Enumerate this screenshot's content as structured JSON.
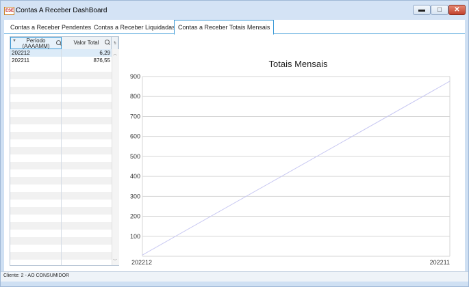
{
  "window": {
    "title": "Contas A Receber DashBoard",
    "icon_text": "ESE",
    "min_glyph": "▬",
    "max_glyph": "□",
    "close_glyph": "✕"
  },
  "tabs": [
    {
      "label": "Contas a Receber Pendentes"
    },
    {
      "label": "Contas a Receber Liquidadas"
    },
    {
      "label": "Contas a Receber Totais Mensais",
      "active": true
    }
  ],
  "grid": {
    "col1_line1": "Período",
    "col1_line2": "(AAAAMM)",
    "col2": "Valor Total",
    "rows": [
      {
        "periodo": "202212",
        "valor": "6,29",
        "selected": true
      },
      {
        "periodo": "202211",
        "valor": "876,55",
        "selected": false
      }
    ]
  },
  "chart_data": {
    "type": "line",
    "title": "Totais Mensais",
    "categories": [
      "202212",
      "202211"
    ],
    "series": [
      {
        "values": [
          6.29,
          876.55
        ]
      }
    ],
    "yticks": [
      100,
      200,
      300,
      400,
      500,
      600,
      700,
      800,
      900
    ],
    "ylim": [
      0,
      900
    ],
    "grid": true,
    "line_color": "#c8c8f2"
  },
  "status": {
    "text": "Cliente: 2 - AO CONSUMIDOR"
  },
  "colors": {
    "accent": "#3c9ad6",
    "selected_row": "#dcebf8",
    "alt_row": "#f1f1f1"
  }
}
